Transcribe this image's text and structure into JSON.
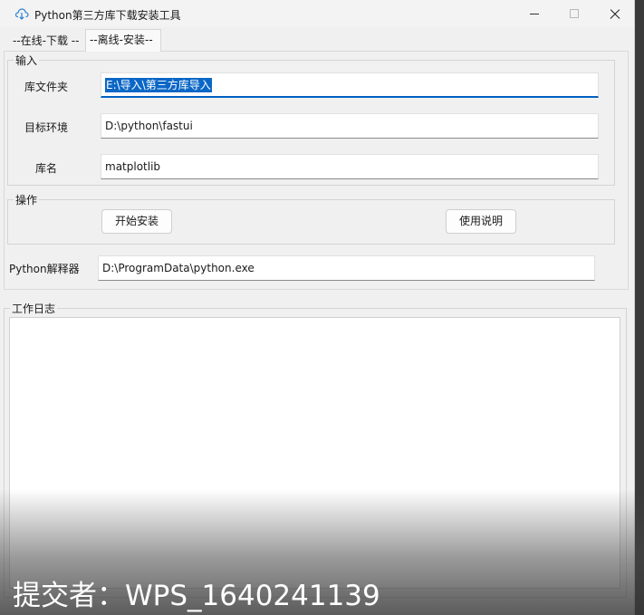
{
  "window": {
    "title": "Python第三方库下载安装工具",
    "icon": "cloud-download-icon"
  },
  "tabs": [
    {
      "label": "--在线-下载 --",
      "active": false
    },
    {
      "label": "--离线-安装--",
      "active": true
    }
  ],
  "input_group": {
    "legend": "输入",
    "fields": [
      {
        "label": "库文件夹",
        "value": "E:\\导入\\第三方库导入",
        "focused": true,
        "selected": true
      },
      {
        "label": "目标环境",
        "value": "D:\\python\\fastui"
      },
      {
        "label": "库名",
        "value": "matplotlib"
      }
    ]
  },
  "ops_group": {
    "legend": "操作",
    "start_install_label": "开始安装",
    "help_label": "使用说明"
  },
  "interpreter": {
    "label": "Python解释器",
    "value": "D:\\ProgramData\\python.exe"
  },
  "log_group": {
    "legend": "工作日志",
    "content": ""
  },
  "watermark": {
    "text": "提交者：WPS_1640241139"
  },
  "colors": {
    "selection": "#0b67c6",
    "focus_underline": "#0060c0",
    "window_bg": "#f0f0f0"
  }
}
